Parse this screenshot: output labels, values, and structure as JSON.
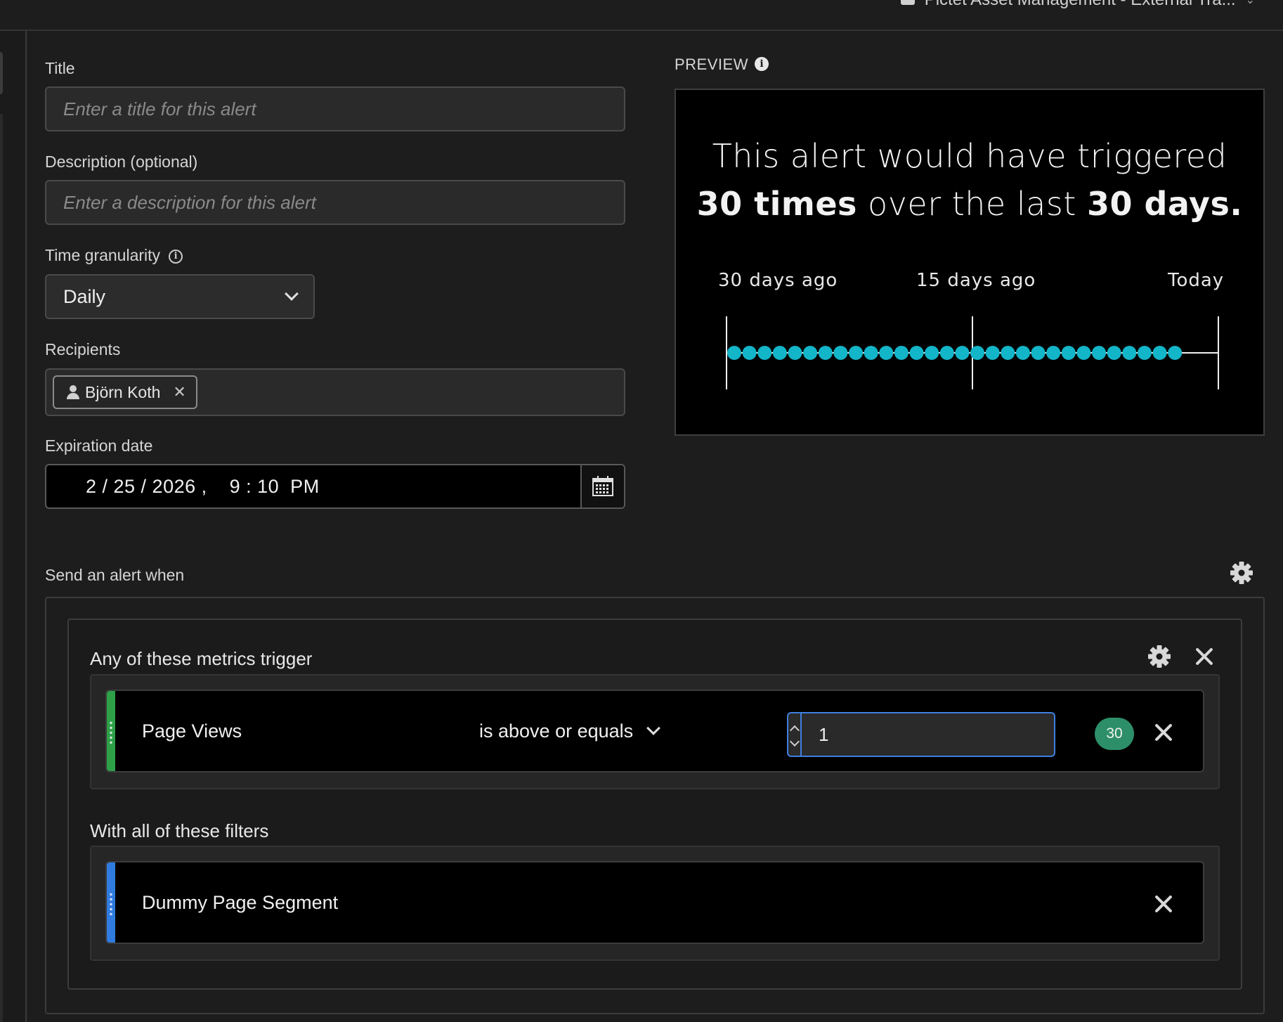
{
  "header": {
    "project_title": "Pictet Asset Management - External Tra...",
    "icon": "folder-icon"
  },
  "form": {
    "title_label": "Title",
    "title_placeholder": "Enter a title for this alert",
    "description_label": "Description (optional)",
    "description_placeholder": "Enter a description for this alert",
    "granularity_label": "Time granularity",
    "granularity_value": "Daily",
    "recipients_label": "Recipients",
    "recipients": [
      {
        "name": "Björn Koth",
        "icon": "person-icon",
        "remove": "✕"
      }
    ],
    "expiration_label": "Expiration date",
    "expiration_value": "2 / 25 / 2026 ,    9 : 10  PM",
    "calendar_icon": "calendar-icon"
  },
  "preview": {
    "label": "PREVIEW",
    "line1": "This alert would have triggered",
    "count_text": "30 times",
    "middle_text": " over the last ",
    "days_text": "30 days.",
    "timeline_labels": [
      "30 days ago",
      "15 days ago",
      "Today"
    ],
    "triggered_count": 30,
    "days": 30,
    "dot_color": "#13b5c8"
  },
  "conditions": {
    "section_label": "Send an alert when",
    "metrics_label": "Any of these metrics trigger",
    "metric": {
      "name": "Page Views",
      "operator": "is above or equals",
      "threshold": "1",
      "trigger_count": "30",
      "accent": "#2da048"
    },
    "filters_label": "With all of these filters",
    "filter": {
      "name": "Dummy Page Segment",
      "accent": "#2f7be0"
    }
  }
}
